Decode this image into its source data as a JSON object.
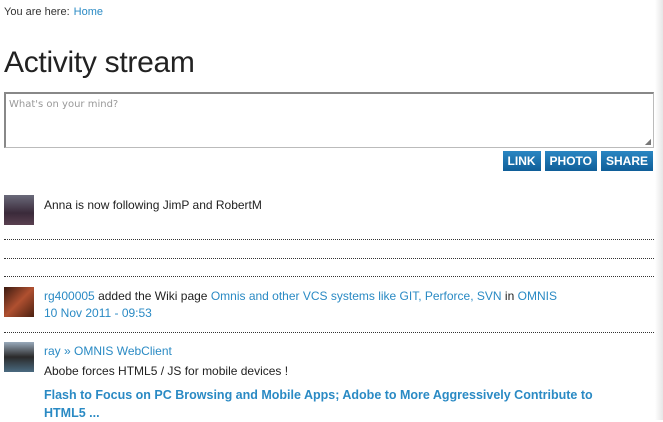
{
  "breadcrumb": {
    "label": "You are here:",
    "home": "Home"
  },
  "title": "Activity stream",
  "composer": {
    "placeholder": "What's on your mind?",
    "buttons": [
      "LINK",
      "PHOTO",
      "SHARE"
    ]
  },
  "stream": [
    {
      "text": "Anna is now following JimP and RobertM"
    },
    {
      "user": "rg400005",
      "action": "added the Wiki page",
      "page": "Omnis and other VCS systems like GIT, Perforce, SVN",
      "in": "in",
      "group": "OMNIS",
      "time": "10 Nov 2011 - 09:53"
    },
    {
      "user": "ray",
      "sep": "»",
      "group": "OMNIS WebClient",
      "text": "Abobe forces HTML5 / JS for mobile devices !",
      "link_title": "Flash to Focus on PC Browsing and Mobile Apps; Adobe to More Aggressively Contribute to HTML5 ..."
    }
  ],
  "colors": {
    "link": "#2a8ac4",
    "button": "#1a6fab"
  }
}
